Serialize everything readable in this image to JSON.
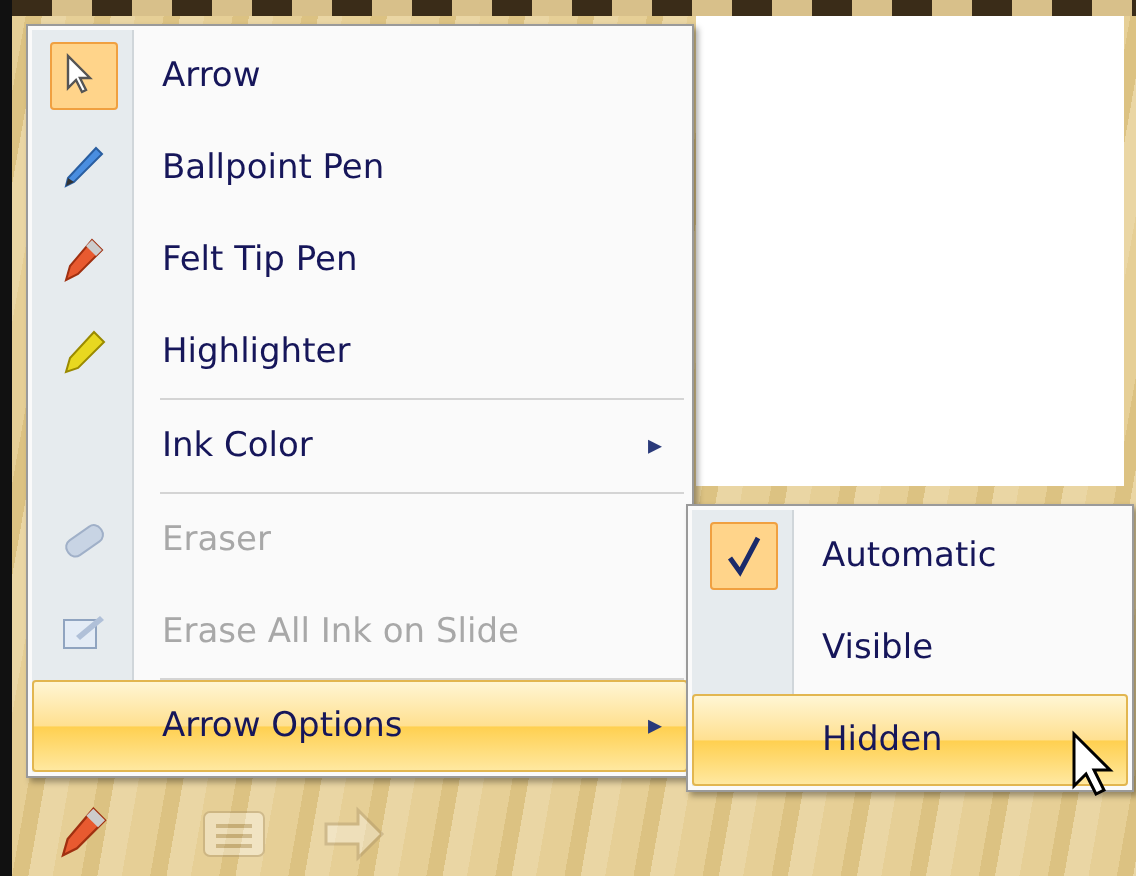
{
  "menu": {
    "items": [
      {
        "kind": "item",
        "label": "Arrow",
        "checked": true,
        "disabled": false,
        "selected": false
      },
      {
        "kind": "item",
        "label": "Ballpoint Pen",
        "checked": false,
        "disabled": false,
        "selected": false
      },
      {
        "kind": "item",
        "label": "Felt Tip Pen",
        "checked": false,
        "disabled": false,
        "selected": false
      },
      {
        "kind": "item",
        "label": "Highlighter",
        "checked": false,
        "disabled": false,
        "selected": false
      },
      {
        "kind": "separator"
      },
      {
        "kind": "submenu",
        "label": "Ink Color",
        "arrow": "▸",
        "disabled": false,
        "selected": false
      },
      {
        "kind": "separator"
      },
      {
        "kind": "item",
        "label": "Eraser",
        "checked": false,
        "disabled": true,
        "selected": false
      },
      {
        "kind": "item",
        "label": "Erase All Ink on Slide",
        "checked": false,
        "disabled": true,
        "selected": false
      },
      {
        "kind": "separator"
      },
      {
        "kind": "submenu",
        "label": "Arrow Options",
        "arrow": "▸",
        "disabled": false,
        "selected": true
      }
    ]
  },
  "submenu": {
    "items": [
      {
        "label": "Automatic",
        "checked": true,
        "selected": false
      },
      {
        "label": "Visible",
        "checked": false,
        "selected": false
      },
      {
        "label": "Hidden",
        "checked": false,
        "selected": true
      }
    ]
  }
}
